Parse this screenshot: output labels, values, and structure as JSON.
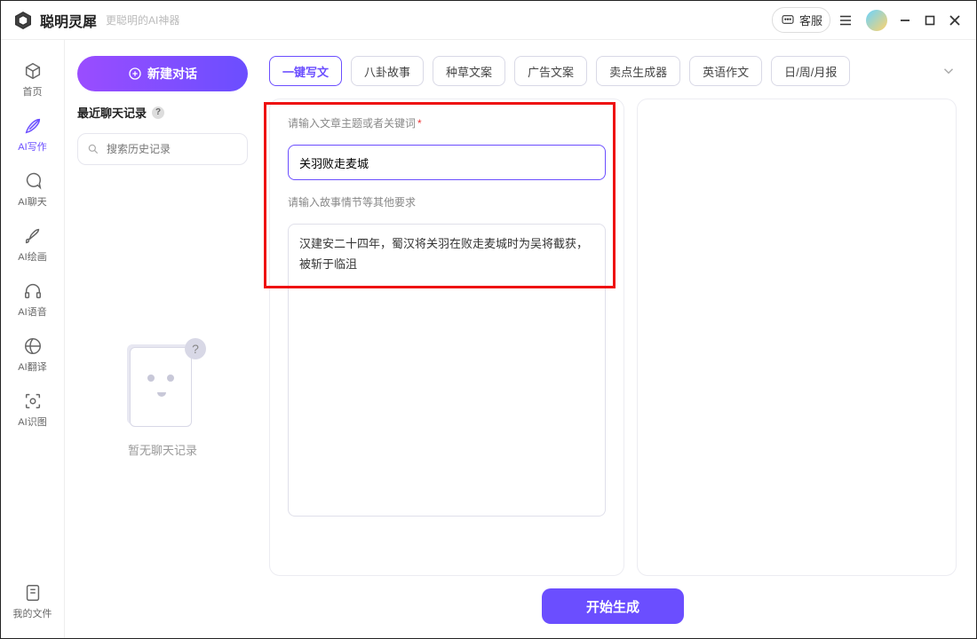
{
  "titlebar": {
    "app_name": "聪明灵犀",
    "tagline": "更聪明的AI神器",
    "support_label": "客服"
  },
  "rail": {
    "items": [
      {
        "label": "首页"
      },
      {
        "label": "AI写作"
      },
      {
        "label": "AI聊天"
      },
      {
        "label": "AI绘画"
      },
      {
        "label": "AI语音"
      },
      {
        "label": "AI翻译"
      },
      {
        "label": "AI识图"
      }
    ],
    "footer_label": "我的文件"
  },
  "col2": {
    "new_chat_label": "新建对话",
    "recent_title": "最近聊天记录",
    "search_placeholder": "搜索历史记录",
    "empty_label": "暂无聊天记录"
  },
  "tabs": {
    "items": [
      "一键写文",
      "八卦故事",
      "种草文案",
      "广告文案",
      "卖点生成器",
      "英语作文",
      "日/周/月报"
    ],
    "active_index": 0
  },
  "form": {
    "topic_label": "请输入文章主题或者关键词",
    "topic_value": "关羽败走麦城",
    "details_label": "请输入故事情节等其他要求",
    "details_value": "汉建安二十四年，蜀汉将关羽在败走麦城时为吴将截获，被斩于临沮",
    "generate_label": "开始生成"
  }
}
